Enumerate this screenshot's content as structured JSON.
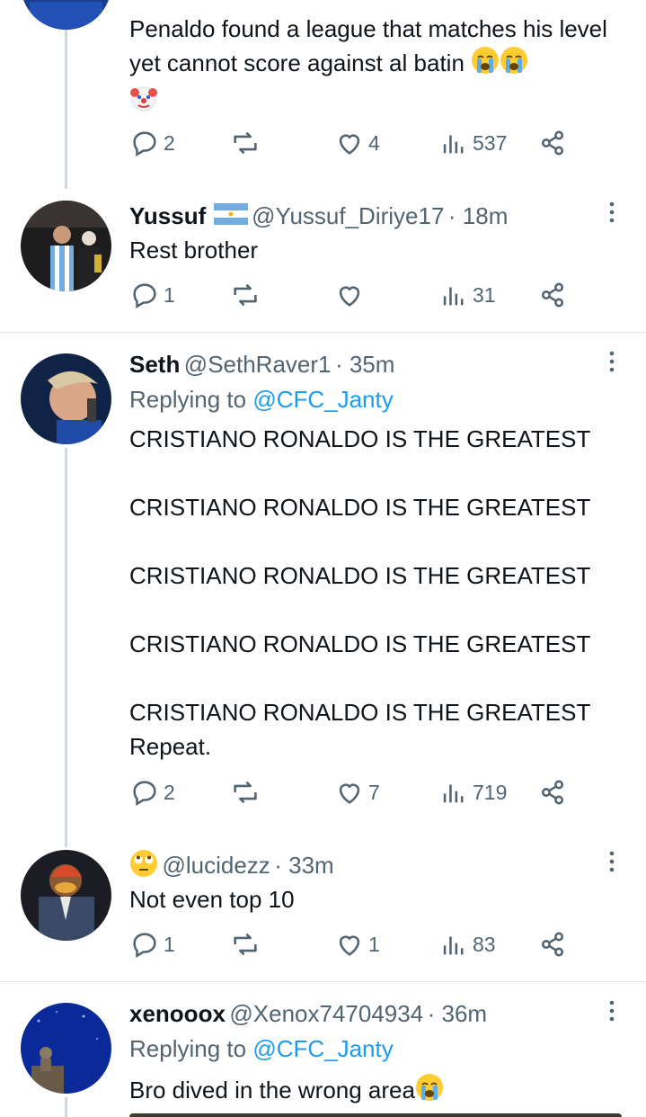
{
  "replies": [
    {
      "display_name": "",
      "handle": "",
      "time": "",
      "text": "Penaldo found a league that matches his level yet cannot score against al batin",
      "emoji_after_text": [
        "loudly-crying-face",
        "loudly-crying-face",
        "clown-face"
      ],
      "stats": {
        "replies": "2",
        "reposts": "",
        "likes": "4",
        "views": "537"
      }
    },
    {
      "display_name": "Yussuf",
      "name_flag": "argentina-flag",
      "handle": "@Yussuf_Diriye17",
      "time": "· 18m",
      "text": "Rest brother",
      "stats": {
        "replies": "1",
        "reposts": "",
        "likes": "",
        "views": "31"
      }
    },
    {
      "display_name": "Seth",
      "handle": "@SethRaver1",
      "time": "· 35m",
      "replying_prefix": "Replying to",
      "replying_to": "@CFC_Janty",
      "lines": [
        "CRISTIANO RONALDO IS THE GREATEST",
        "CRISTIANO RONALDO IS THE GREATEST",
        "CRISTIANO RONALDO IS THE GREATEST",
        "CRISTIANO RONALDO IS THE GREATEST",
        "CRISTIANO RONALDO IS THE GREATEST",
        "Repeat."
      ],
      "stats": {
        "replies": "2",
        "reposts": "",
        "likes": "7",
        "views": "719"
      }
    },
    {
      "display_name": "",
      "name_emoji": "face-with-rolling-eyes",
      "handle": "@lucidezz",
      "time": "· 33m",
      "text": "Not even top 10",
      "stats": {
        "replies": "1",
        "reposts": "",
        "likes": "1",
        "views": "83"
      }
    },
    {
      "display_name": "xenooox",
      "handle": "@Xenox74704934",
      "time": "· 36m",
      "replying_prefix": "Replying to",
      "replying_to": "@CFC_Janty",
      "text": "Bro dived in the wrong area",
      "emoji_after_text": [
        "loudly-crying-face"
      ]
    }
  ],
  "colors": {
    "text": "#0f1419",
    "secondary": "#536471",
    "link": "#1d9bf0",
    "thread_line": "#cfd9de"
  },
  "icons": [
    "reply-icon",
    "repost-icon",
    "like-icon",
    "views-icon",
    "share-icon",
    "more-icon"
  ]
}
